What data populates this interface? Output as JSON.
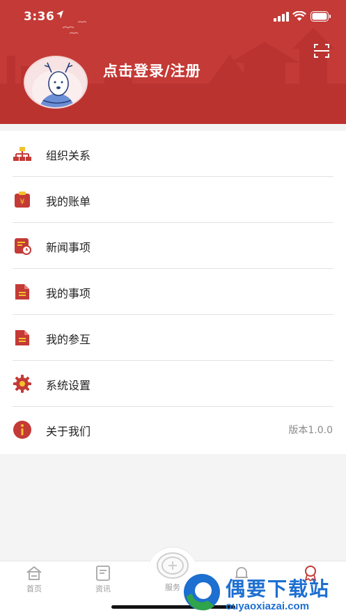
{
  "status_bar": {
    "time": "3:36"
  },
  "header": {
    "login_label": "点击登录/注册"
  },
  "menu": {
    "items": [
      {
        "label": "组织关系",
        "icon": "org-chart-icon"
      },
      {
        "label": "我的账单",
        "icon": "bill-icon"
      },
      {
        "label": "新闻事项",
        "icon": "news-icon"
      },
      {
        "label": "我的事项",
        "icon": "document-icon"
      },
      {
        "label": "我的参互",
        "icon": "document-icon"
      },
      {
        "label": "系统设置",
        "icon": "gear-icon"
      },
      {
        "label": "关于我们",
        "icon": "info-icon",
        "value": "版本1.0.0"
      }
    ]
  },
  "tabbar": {
    "tabs": [
      {
        "label": "首页",
        "icon": "home-icon"
      },
      {
        "label": "资讯",
        "icon": "news-icon"
      },
      {
        "label": "服务",
        "icon": "service-icon"
      },
      {
        "label": "",
        "icon": "bell-icon"
      },
      {
        "label": "",
        "icon": "profile-badge-icon"
      }
    ]
  },
  "watermark": {
    "title": "偶要下载站",
    "url": "ouyaoxiazai.com"
  },
  "colors": {
    "brand": "#c43a36",
    "text": "#222222",
    "muted": "#8a8a8a"
  }
}
